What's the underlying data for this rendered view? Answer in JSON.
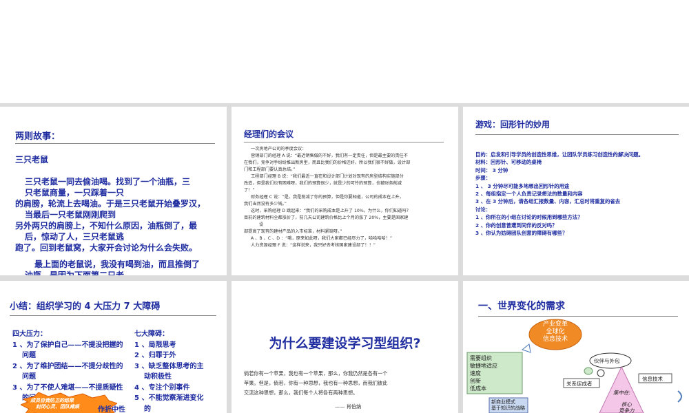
{
  "slide1": {
    "title": "两则故事：",
    "subtitle": "三只老鼠",
    "para1_l1": "三只老鼠一同去偷油喝。找到了一个油瓶，三",
    "para1_l2": "只老鼠商量，一只踩着一只",
    "para1_l3": "的肩膀，轮流上去喝油。于是三只老鼠开始叠罗汉，",
    "para1_l4": "当最后一只老鼠刚刚爬到",
    "para1_l5": "另外两只的肩膀上，不知什么原因，油瓶倒了，最",
    "para1_l6": "后，惊动了人，三只老鼠逃",
    "para1_l7": "跑了。回到老鼠窝，大家开会讨论为什么会失败。",
    "para2_l1": "最上面的老鼠说，我没有喝到油，而且推倒了",
    "para2_l2": "油瓶，是因为下面第二只老"
  },
  "slide2": {
    "title": "经理们的会议",
    "lines": [
      "一次房地产公司的季度会议：",
      "营销部门的经理 A 说：“最近销售做的不好，我们有一定责任，但是最主要的责任不",
      "在我们，竞争对手纷纷推出新房型，而且比我们的价格还好，所以我们很不好做，设计部",
      "门和工程部门要认真总结。”",
      "工程部门经理 B 说：“我们最近一直在和设计部门计划对现有的房型结构实施部分",
      "改造，但是我们也有困难呀，我们的预算很少，就是少的可怜的预算，也被财务削减",
      "了！”",
      "财务经理 C 说：“是，我是削减了你的预算，但是你要知道，公司的成本在上升，",
      "我们当然没有多少钱。”",
      "这时，采购经理 D 跳起来：“我们的采购成本是上升了 10%，为什么，你们知道吗？",
      "目前的建筑材料全都涨价了，前几天公司建筑价格比上个月的涨了 20%，主要是国家建",
      "设",
      "部提高了现有的建材产品的入市标准，材料紧缺呀。”",
      "A 、B 、C 、D ：“哦，原来如此呀，我们大家都已经尽力了，哈哈哈哈！”",
      "人力资源经理 F 说：“这样说来，我只好去考核国家建设部了！！”"
    ]
  },
  "slide3": {
    "title": "游戏：回形针的妙用",
    "lines": [
      "目的：启发和引导学员的创造性思维，让团队学员练习创造性的解决问题。",
      "材料：回形针、可移动的桌椅",
      "时间：  3 分钟",
      "步骤：",
      "1 、  3 分钟尽可能多地想出回形针的用途",
      "2 、每组指定一个人负责记录想法的数量和内容",
      "3 、在 3 分钟后，请各组汇报数量、内容，汇总时将重复的省去",
      "讨论：",
      "1 、你所在的小组在讨论的时候用到哪些方法？",
      "2 、你的创意曾遭到同伴的反对吗？",
      "3 、你认为妨碍团队创意的障碍有哪些？"
    ]
  },
  "slide4": {
    "title": "小结：组织学习的 4 大压力 7 大障碍",
    "left_head": "四大压力：",
    "left_items": [
      "1 、为了保护自己——不提没把握的",
      "问题",
      "2 、为了维护团结——不提分歧性的",
      "问题",
      "3 、为了不使人难堪——不提质疑性",
      "的问"
    ],
    "right_head": "七大障碍：",
    "right_items": [
      "1 、局限思考",
      "2 、归罪于外",
      "3 、缺乏整体思考的主",
      "动积极性",
      "4 、专注个别事件",
      "5 、不能觉察渐进变化",
      "的"
    ],
    "burst_line1": "成员自我防卫的结果",
    "burst_line2": "封闭心灵、团队瘫痪",
    "partial_text": "作折中性"
  },
  "slide5": {
    "title": "为什么要建设学习型组织?",
    "lines": [
      "倘若你有一个苹果，我也有一个苹果，那么，你我仍然是各有一个",
      "苹果。但是，倘若，你有一种思想，我也有一种思想，而我们彼此",
      "交流这种思想，那么，我们每个人将各有两种思想。"
    ],
    "signature": "—— 肖伯纳"
  },
  "slide6": {
    "title": "一、世界变化的需求",
    "bubble_lines": [
      "产业变革",
      "全球化",
      "信息技术"
    ],
    "needs_box": [
      "需要组织",
      "敏捷地适应",
      "速度",
      "创新",
      "低成本"
    ],
    "partner_label": "伙伴与外包",
    "relation_label": "关系促成者",
    "it_label": "信息技术",
    "focus_label": "集中在:",
    "core_label1": "核心",
    "core_label2": "竞争力",
    "new_biz1": "新商业模式",
    "new_biz2": "基于知识的战略"
  },
  "colors": {
    "accent": "#1f2da0",
    "bubble": "#f08a25",
    "burst": "#ff8c1a",
    "needs_bg": "#cde9c9",
    "triangle": "#f4c6e7"
  }
}
